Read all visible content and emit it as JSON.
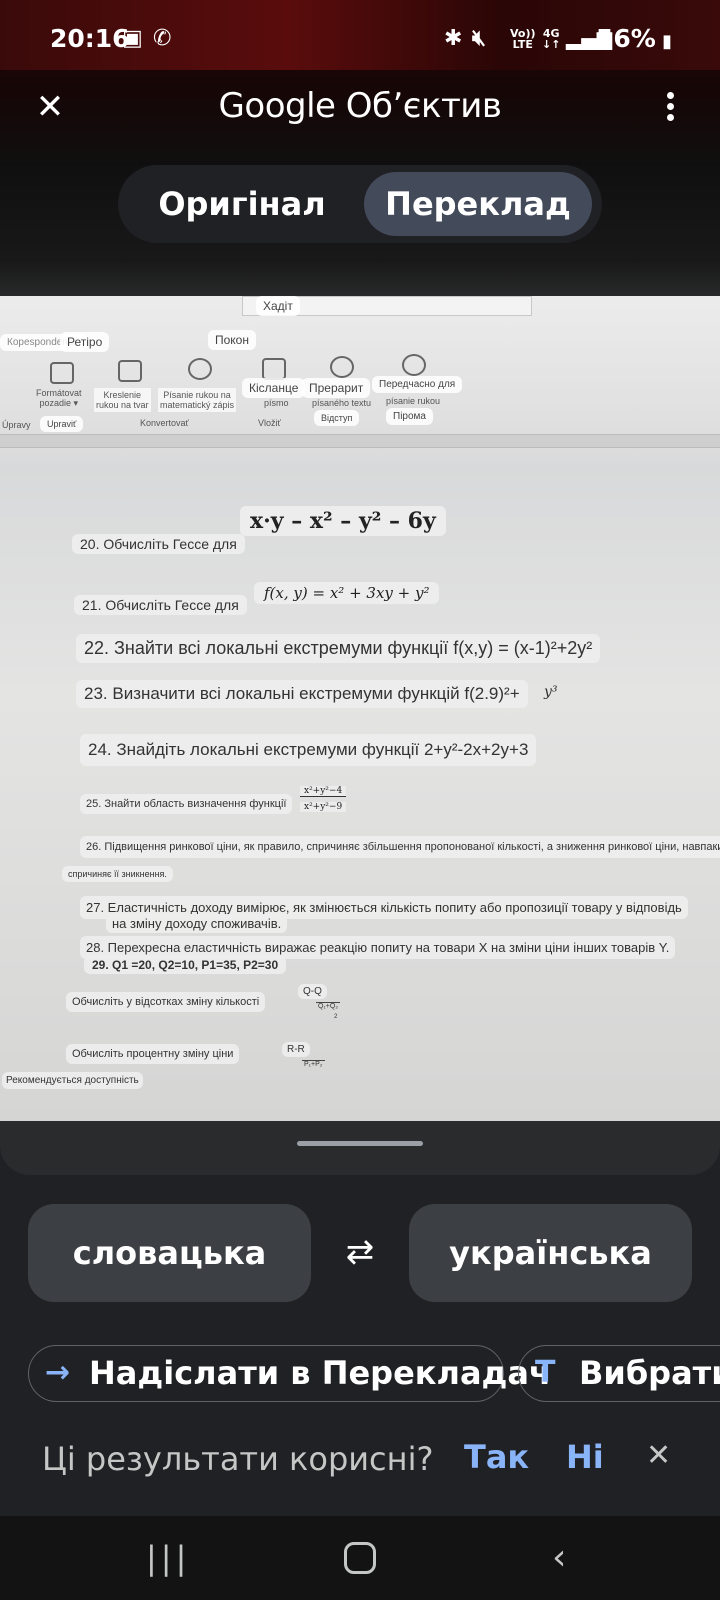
{
  "status": {
    "time": "20:16",
    "battery": "56%",
    "net_top": "Vo))",
    "net_bottom": "LTE",
    "net_4g": "4G"
  },
  "appbar": {
    "title": "Google Об’єктив"
  },
  "segment": {
    "original": "Оригінал",
    "translation": "Переклад"
  },
  "ribbon": {
    "search": "Хадіт",
    "tab_left": "Кореspondencia",
    "tab_retiro": "Ретіро",
    "tab_pokon": "Покон",
    "g1_top": "Formátovat",
    "g1_bot": "pozadie",
    "g2_a": "Kreslenie",
    "g2_b": "rukou na tvar",
    "g3_a": "Písanie rukou na",
    "g3_b": "matematický zápis",
    "g4": "Кісланце",
    "g4_sub": "písmo",
    "g5": "Прерарит",
    "g5_sub": "písaného textu",
    "g6": "Передчасно для",
    "g6_sub": "písanie rukou",
    "lbl_uprav": "Upraviť",
    "lbl_konverto": "Konvertovať",
    "lbl_vlozit": "Vložiť",
    "lbl_vidstup": "Відступ",
    "lbl_piroma": "Пірома",
    "lbl_edit": "Úpravy"
  },
  "doc": {
    "i20": "20. Обчисліть Гессе для",
    "i20_math": "x·y – x² – y² – 6y",
    "i21": "21. Обчисліть Гессе для",
    "i21_math": "f(x, y) = x² + 3xy + y²",
    "i22": "22. Знайти всі локальні екстремуми функції f(x,y) = (x-1)²+2y²",
    "i23": "23. Визначити всі локальні екстремуми функцій f(2.9)²+",
    "i23_tail": "y³",
    "i24": "24. Знайдіть локальні екстремуми функції 2+y²-2x+2y+3",
    "i25": "25. Знайти область визначення функції",
    "i25_num": "x²+y²−4",
    "i25_den": "x²+y²−9",
    "i26": "26. Підвищення ринкової ціни, як правило, спричиняє збільшення пропонованої кількості, а зниження ринкової ціни, навпаки,",
    "i26b": "спричиняє її зникнення.",
    "i27": "27. Еластичність доходу вимірює, як змінюється кількість попиту або пропозиції товару у відповідь",
    "i27b": "на зміну доходу споживачів.",
    "i28": "28. Перехресна еластичність виражає реакцію попиту на товари X на зміни ціни інших товарів Y.",
    "i29": "29. Q1 =20, Q2=10, P1=35, P2=30",
    "q_change": "Обчисліть у відсотках зміну кількості",
    "q_frac": "Q-Q",
    "q_den": "Q₁+Q₂",
    "q_two": "2",
    "p_change": "Обчисліть процентну зміну ціни",
    "p_frac": "R-R",
    "p_den": "P₁+P₂",
    "access": "Рекомендується доступність"
  },
  "languages": {
    "source": "словацька",
    "target": "українська"
  },
  "actions": {
    "send": "Надіслати в Перекладач",
    "select": "Вибрати"
  },
  "feedback": {
    "question": "Ці результати корисні?",
    "yes": "Так",
    "no": "Ні"
  },
  "colors": {
    "accent": "#8ab4f8",
    "selected_segment": "#434a5a",
    "background": "#202124"
  }
}
